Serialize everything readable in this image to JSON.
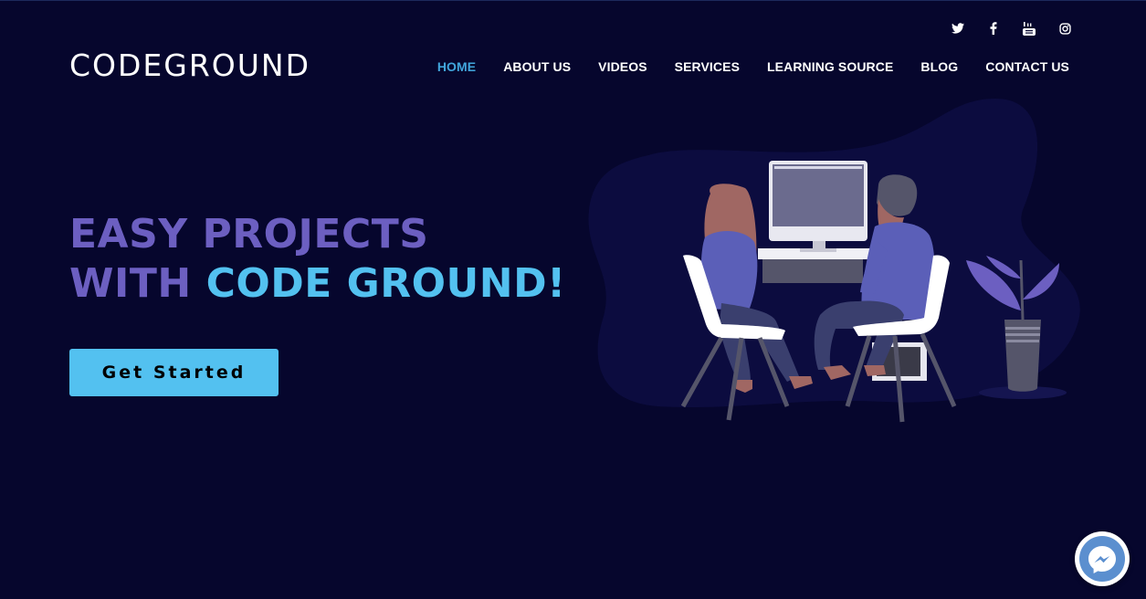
{
  "brand": {
    "logo_text": "CODEGROUND"
  },
  "social": [
    {
      "icon": "twitter-icon"
    },
    {
      "icon": "facebook-icon"
    },
    {
      "icon": "youtube-icon"
    },
    {
      "icon": "instagram-icon"
    }
  ],
  "nav": {
    "items": [
      {
        "label": "HOME",
        "active": true
      },
      {
        "label": "ABOUT US"
      },
      {
        "label": "VIDEOS"
      },
      {
        "label": "SERVICES"
      },
      {
        "label": "LEARNING SOURCE"
      },
      {
        "label": "BLOG"
      },
      {
        "label": "CONTACT US"
      }
    ]
  },
  "hero": {
    "line1": "EASY PROJECTS",
    "line2_prefix": "WITH ",
    "line2_highlight": "CODE GROUND!",
    "cta_label": "Get Started"
  },
  "colors": {
    "background": "#06062d",
    "accent_purple": "#6c5fc1",
    "accent_blue": "#53c1f0",
    "nav_active": "#41a5dc"
  },
  "widgets": {
    "chat_icon": "messenger-icon"
  }
}
